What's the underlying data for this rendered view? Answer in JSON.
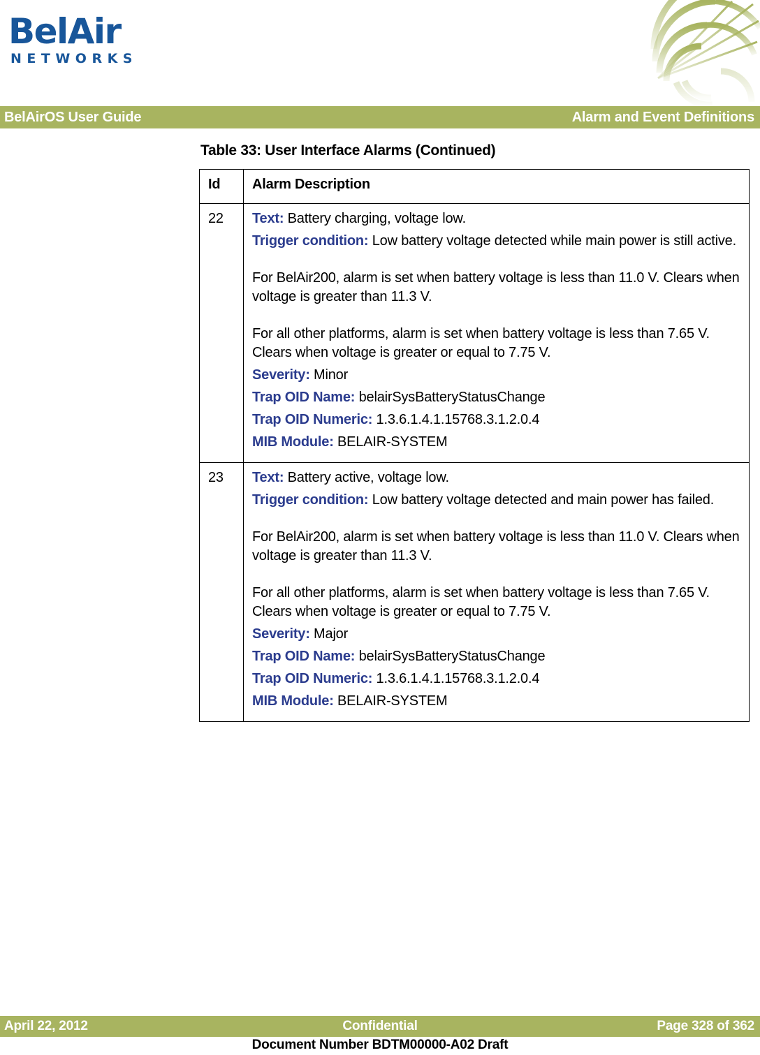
{
  "brand": {
    "logo_line1": "BelAir",
    "logo_line2": "NETWORKS",
    "logo_color": "#18569A",
    "decorative_graphic": "fan-web-graphic",
    "graphic_color": "#A8B460"
  },
  "header": {
    "left_title": "BelAirOS User Guide",
    "right_title": "Alarm and Event Definitions",
    "band_color": "#A8B460",
    "text_color": "#FFFFFF"
  },
  "table": {
    "caption": "Table 33: User Interface Alarms  (Continued)",
    "columns": [
      "Id",
      "Alarm Description"
    ],
    "label_color": "#2B3C8E",
    "rows": [
      {
        "id": "22",
        "blocks": [
          {
            "label": "Text:",
            "value": "Battery charging, voltage low.",
            "gap_before": false
          },
          {
            "label": "Trigger condition:",
            "value": "Low battery voltage detected while main power is still active.",
            "gap_before": false
          },
          {
            "label": "",
            "value": "For BelAir200, alarm is set when battery voltage is less than 11.0 V. Clears when voltage is greater than 11.3 V.",
            "gap_before": true
          },
          {
            "label": "",
            "value": "For all other platforms, alarm is set when battery voltage is less than 7.65 V. Clears when voltage is greater or equal to 7.75 V.",
            "gap_before": true
          },
          {
            "label": "Severity:",
            "value": "Minor",
            "gap_before": false
          },
          {
            "label": "Trap OID Name:",
            "value": "belairSysBatteryStatusChange",
            "gap_before": false
          },
          {
            "label": "Trap OID Numeric:",
            "value": "1.3.6.1.4.1.15768.3.1.2.0.4",
            "gap_before": false
          },
          {
            "label": "MIB Module:",
            "value": "BELAIR-SYSTEM",
            "gap_before": false
          }
        ]
      },
      {
        "id": "23",
        "blocks": [
          {
            "label": "Text:",
            "value": "Battery active, voltage low.",
            "gap_before": false
          },
          {
            "label": "Trigger condition:",
            "value": "Low battery voltage detected and main power has failed.",
            "gap_before": false
          },
          {
            "label": "",
            "value": "For BelAir200, alarm is set when battery voltage is less than 11.0 V. Clears when voltage is greater than 11.3 V.",
            "gap_before": true
          },
          {
            "label": "",
            "value": "For all other platforms, alarm is set when battery voltage is less than 7.65 V. Clears when voltage is greater or equal to 7.75 V.",
            "gap_before": true
          },
          {
            "label": "Severity:",
            "value": "Major",
            "gap_before": false
          },
          {
            "label": "Trap OID Name:",
            "value": "belairSysBatteryStatusChange",
            "gap_before": false
          },
          {
            "label": "Trap OID Numeric:",
            "value": "1.3.6.1.4.1.15768.3.1.2.0.4",
            "gap_before": false
          },
          {
            "label": "MIB Module:",
            "value": "BELAIR-SYSTEM",
            "gap_before": false
          }
        ]
      }
    ]
  },
  "footer": {
    "date": "April 22, 2012",
    "confidentiality": "Confidential",
    "page": "Page 328 of 362",
    "document_number": "Document Number BDTM00000-A02 Draft",
    "band_color": "#A8B460"
  }
}
